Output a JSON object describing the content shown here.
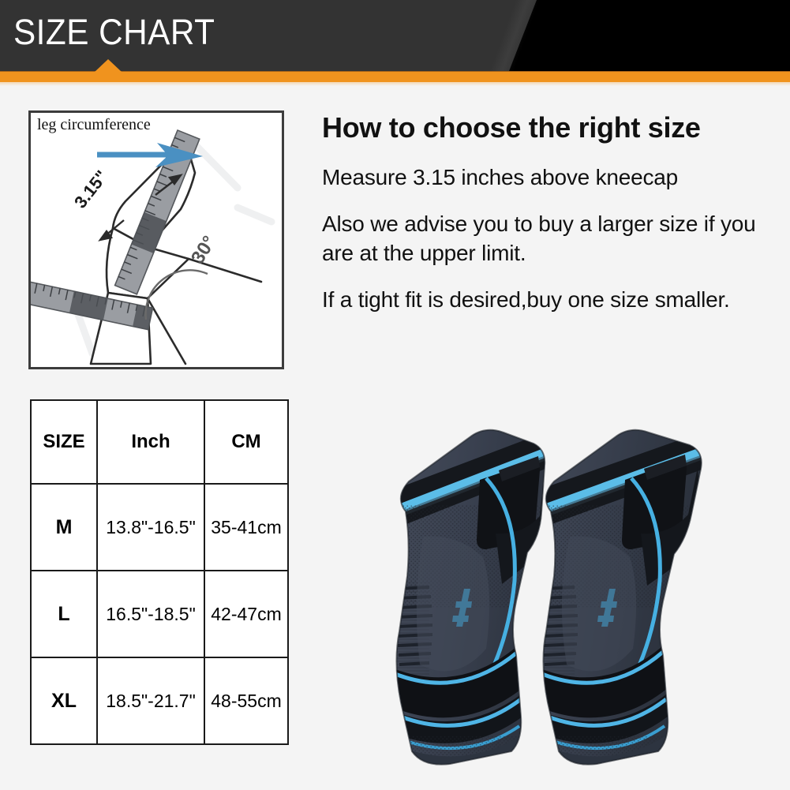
{
  "header": {
    "title": "SIZE CHART",
    "bar_color": "#f0931e",
    "panel_color": "#333333",
    "accent_black": "#000000"
  },
  "diagram": {
    "label_leg_circumference": "leg circumference",
    "label_measure": "3.15\"",
    "label_angle": "30°",
    "arrow_color": "#4a90c2",
    "border_color": "#3c3c3c",
    "icons": {
      "arrow": "right-arrow-icon",
      "leg": "leg-outline-icon",
      "tape": "tape-measure-icon",
      "angle": "angle-arc-icon"
    }
  },
  "info": {
    "heading": "How to choose the right size",
    "paragraphs": [
      "Measure 3.15 inches above kneecap",
      "Also we advise you to buy a larger size if you are at the upper limit.",
      "If a tight fit is desired,buy one size smaller."
    ]
  },
  "size_table": {
    "headers": [
      "SIZE",
      "Inch",
      "CM"
    ],
    "rows": [
      {
        "size": "M",
        "inch": "13.8\"-16.5\"",
        "cm": "35-41cm"
      },
      {
        "size": "L",
        "inch": "16.5\"-18.5\"",
        "cm": "42-47cm"
      },
      {
        "size": "XL",
        "inch": "18.5\"-21.7\"",
        "cm": "48-55cm"
      }
    ]
  },
  "product": {
    "name": "knee-brace-pair",
    "count": 2,
    "colors": {
      "body_gray": "#3d4452",
      "body_gray_dark": "#2e343f",
      "panel_black": "#141619",
      "accent_blue": "#2fa6de",
      "accent_blue_light": "#5bbde8",
      "background": "#f4f4f4"
    }
  }
}
